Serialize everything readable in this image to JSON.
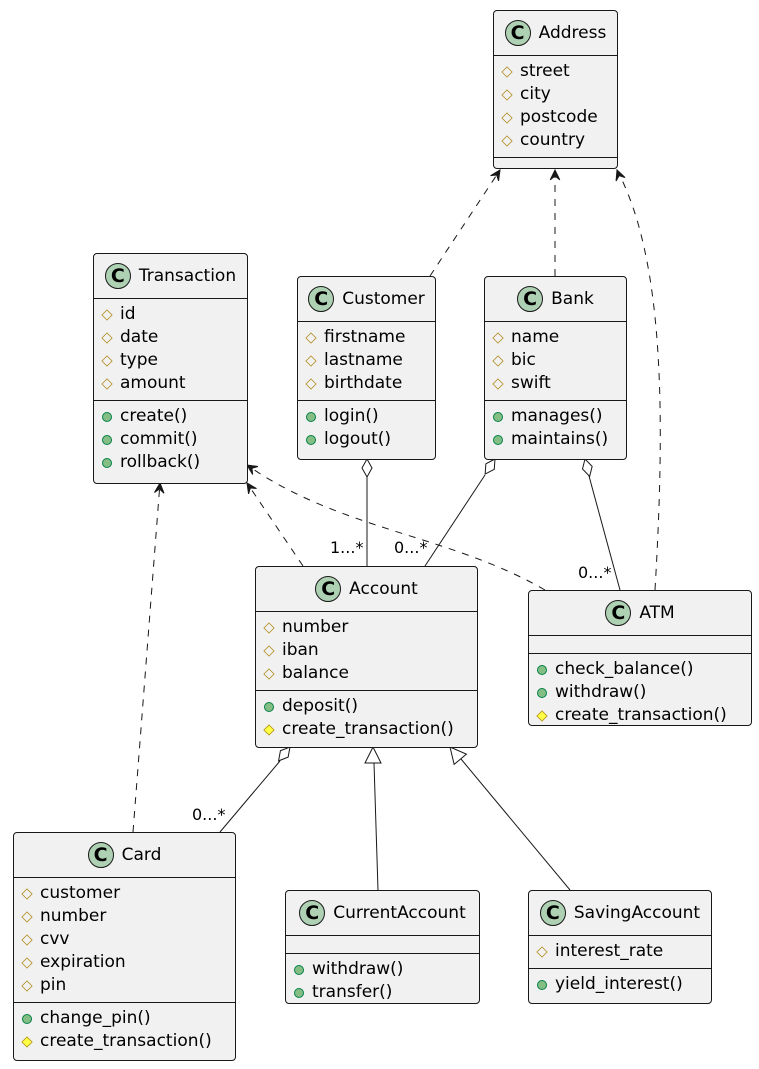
{
  "colors": {
    "class_background": "#F1F1F1",
    "class_icon": "#ADD1B2",
    "protected": "#B38D22",
    "public": "#84BE84",
    "protected_method": "#FFFF44",
    "line": "#181818"
  },
  "classes": [
    {
      "name": "Address",
      "icon": "C",
      "attributes": [
        {
          "vis": "protected",
          "name": "street"
        },
        {
          "vis": "protected",
          "name": "city"
        },
        {
          "vis": "protected",
          "name": "postcode"
        },
        {
          "vis": "protected",
          "name": "country"
        }
      ],
      "methods": []
    },
    {
      "name": "Transaction",
      "icon": "C",
      "attributes": [
        {
          "vis": "protected",
          "name": "id"
        },
        {
          "vis": "protected",
          "name": "date"
        },
        {
          "vis": "protected",
          "name": "type"
        },
        {
          "vis": "protected",
          "name": "amount"
        }
      ],
      "methods": [
        {
          "vis": "public",
          "name": "create()"
        },
        {
          "vis": "public",
          "name": "commit()"
        },
        {
          "vis": "public",
          "name": "rollback()"
        }
      ]
    },
    {
      "name": "Customer",
      "icon": "C",
      "attributes": [
        {
          "vis": "protected",
          "name": "firstname"
        },
        {
          "vis": "protected",
          "name": "lastname"
        },
        {
          "vis": "protected",
          "name": "birthdate"
        }
      ],
      "methods": [
        {
          "vis": "public",
          "name": "login()"
        },
        {
          "vis": "public",
          "name": "logout()"
        }
      ]
    },
    {
      "name": "Bank",
      "icon": "C",
      "attributes": [
        {
          "vis": "protected",
          "name": "name"
        },
        {
          "vis": "protected",
          "name": "bic"
        },
        {
          "vis": "protected",
          "name": "swift"
        }
      ],
      "methods": [
        {
          "vis": "public",
          "name": "manages()"
        },
        {
          "vis": "public",
          "name": "maintains()"
        }
      ]
    },
    {
      "name": "Account",
      "icon": "C",
      "attributes": [
        {
          "vis": "protected",
          "name": "number"
        },
        {
          "vis": "protected",
          "name": "iban"
        },
        {
          "vis": "protected",
          "name": "balance"
        }
      ],
      "methods": [
        {
          "vis": "public",
          "name": "deposit()"
        },
        {
          "vis": "protected-method",
          "name": "create_transaction()"
        }
      ]
    },
    {
      "name": "ATM",
      "icon": "C",
      "attributes": [],
      "methods": [
        {
          "vis": "public",
          "name": "check_balance()"
        },
        {
          "vis": "public",
          "name": "withdraw()"
        },
        {
          "vis": "protected-method",
          "name": "create_transaction()"
        }
      ]
    },
    {
      "name": "Card",
      "icon": "C",
      "attributes": [
        {
          "vis": "protected",
          "name": "customer"
        },
        {
          "vis": "protected",
          "name": "number"
        },
        {
          "vis": "protected",
          "name": "cvv"
        },
        {
          "vis": "protected",
          "name": "expiration"
        },
        {
          "vis": "protected",
          "name": "pin"
        }
      ],
      "methods": [
        {
          "vis": "public",
          "name": "change_pin()"
        },
        {
          "vis": "protected-method",
          "name": "create_transaction()"
        }
      ]
    },
    {
      "name": "CurrentAccount",
      "icon": "C",
      "attributes": [],
      "methods": [
        {
          "vis": "public",
          "name": "withdraw()"
        },
        {
          "vis": "public",
          "name": "transfer()"
        }
      ]
    },
    {
      "name": "SavingAccount",
      "icon": "C",
      "attributes": [
        {
          "vis": "protected",
          "name": "interest_rate"
        }
      ],
      "methods": [
        {
          "vis": "public",
          "name": "yield_interest()"
        }
      ]
    }
  ],
  "relations": [
    {
      "from": "Customer",
      "to": "Address",
      "type": "dependency"
    },
    {
      "from": "Bank",
      "to": "Address",
      "type": "dependency"
    },
    {
      "from": "ATM",
      "to": "Address",
      "type": "dependency"
    },
    {
      "from": "Account",
      "to": "Transaction",
      "type": "dependency"
    },
    {
      "from": "ATM",
      "to": "Transaction",
      "type": "dependency"
    },
    {
      "from": "Card",
      "to": "Transaction",
      "type": "dependency"
    },
    {
      "from": "Customer",
      "to": "Account",
      "type": "aggregation",
      "multiplicity": "1...*"
    },
    {
      "from": "Bank",
      "to": "Account",
      "type": "aggregation",
      "multiplicity": "0...*"
    },
    {
      "from": "Bank",
      "to": "ATM",
      "type": "aggregation",
      "multiplicity": "0...*"
    },
    {
      "from": "Account",
      "to": "Card",
      "type": "aggregation",
      "multiplicity": "0...*"
    },
    {
      "from": "CurrentAccount",
      "to": "Account",
      "type": "inheritance"
    },
    {
      "from": "SavingAccount",
      "to": "Account",
      "type": "inheritance"
    }
  ]
}
